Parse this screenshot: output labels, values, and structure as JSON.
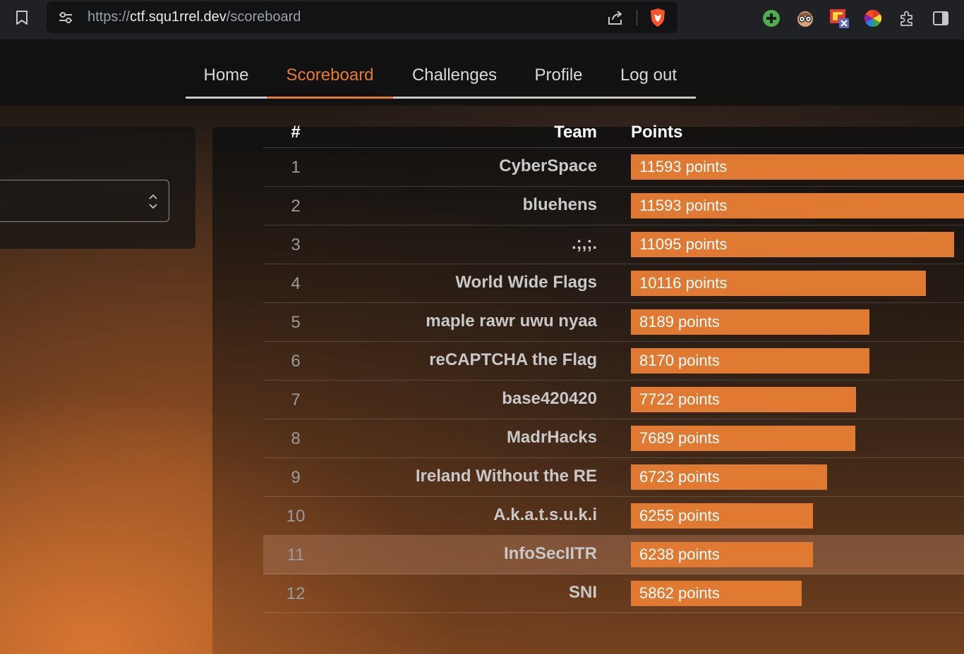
{
  "browser": {
    "url_scheme": "https://",
    "url_host": "ctf.squ1rrel.dev",
    "url_path": "/scoreboard",
    "extensions": [
      "add-extension-icon",
      "glasses-face-extension-icon",
      "puzzle-flag-extension-icon",
      "color-wheel-extension-icon",
      "extensions-puzzle-icon",
      "sidebar-toggle-icon"
    ]
  },
  "nav": {
    "items": [
      {
        "label": "Home",
        "active": false
      },
      {
        "label": "Scoreboard",
        "active": true
      },
      {
        "label": "Challenges",
        "active": false
      },
      {
        "label": "Profile",
        "active": false
      },
      {
        "label": "Log out",
        "active": false
      }
    ]
  },
  "colors": {
    "accent": "#e67a2e",
    "bar": "#e07a32"
  },
  "scoreboard": {
    "headers": {
      "rank": "#",
      "team": "Team",
      "points": "Points"
    },
    "max_points": 11593,
    "rows": [
      {
        "rank": "1",
        "team": "CyberSpace",
        "points": 11593,
        "label": "11593 points"
      },
      {
        "rank": "2",
        "team": "bluehens",
        "points": 11593,
        "label": "11593 points"
      },
      {
        "rank": "3",
        "team": ".;,;.",
        "points": 11095,
        "label": "11095 points"
      },
      {
        "rank": "4",
        "team": "World Wide Flags",
        "points": 10116,
        "label": "10116 points"
      },
      {
        "rank": "5",
        "team": "maple rawr uwu nyaa",
        "points": 8189,
        "label": "8189 points"
      },
      {
        "rank": "6",
        "team": "reCAPTCHA the Flag",
        "points": 8170,
        "label": "8170 points"
      },
      {
        "rank": "7",
        "team": "base420420",
        "points": 7722,
        "label": "7722 points"
      },
      {
        "rank": "8",
        "team": "MadrHacks",
        "points": 7689,
        "label": "7689 points"
      },
      {
        "rank": "9",
        "team": "Ireland Without the RE",
        "points": 6723,
        "label": "6723 points"
      },
      {
        "rank": "10",
        "team": "A.k.a.t.s.u.k.i",
        "points": 6255,
        "label": "6255 points"
      },
      {
        "rank": "11",
        "team": "InfoSecIITR",
        "points": 6238,
        "label": "6238 points",
        "highlight": true
      },
      {
        "rank": "12",
        "team": "SNI",
        "points": 5862,
        "label": "5862 points"
      }
    ]
  }
}
